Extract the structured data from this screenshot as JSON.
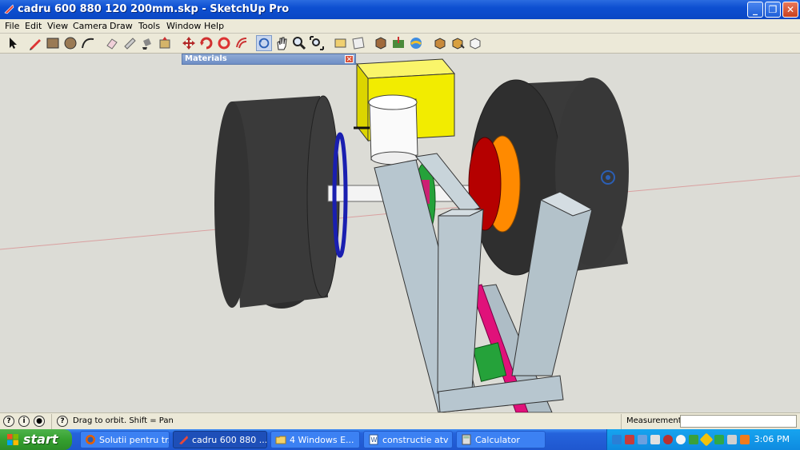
{
  "window": {
    "title": "cadru 600 880 120 200mm.skp - SketchUp Pro",
    "controls": [
      "minimize",
      "maximize",
      "close"
    ]
  },
  "menu": [
    "File",
    "Edit",
    "View",
    "Camera",
    "Draw",
    "Tools",
    "Window",
    "Help"
  ],
  "toolbar": {
    "icons": [
      "select-icon",
      "pencil-icon",
      "rectangle-icon",
      "circle-icon",
      "arc-icon",
      "eraser-icon",
      "tape-measure-icon",
      "paint-bucket-icon",
      "push-pull-icon",
      "move-icon",
      "rotate-icon",
      "follow-me-icon",
      "orbit-icon",
      "pan-icon",
      "zoom-icon",
      "zoom-extents-icon",
      "section-icon",
      "preview-icon",
      "components-icon",
      "geo-location-icon",
      "styles-icon",
      "upload-icon",
      "download-icon",
      "share-icon"
    ],
    "active": "orbit-icon"
  },
  "materials_panel": {
    "title": "Materials"
  },
  "status": {
    "text": "Drag to orbit.  Shift = Pan",
    "measurements_label": "Measurements",
    "measurements_value": ""
  },
  "taskbar": {
    "start_label": "start",
    "tasks": [
      {
        "label": "Solutii pentru tr...",
        "icon": "firefox-icon",
        "active": false
      },
      {
        "label": "cadru 600 880 ...",
        "icon": "sketchup-icon",
        "active": true
      },
      {
        "label": "4 Windows E...",
        "icon": "folder-icon",
        "active": false
      },
      {
        "label": "constructie atv ...",
        "icon": "word-icon",
        "active": false
      },
      {
        "label": "Calculator",
        "icon": "calculator-icon",
        "active": false
      }
    ],
    "clock": "3:06 PM"
  },
  "colors": {
    "title_bar": "#0d4fd1",
    "viewport_bg": "#dcdcd6",
    "tire": "#3a3a3a",
    "frame": "#b7c6cf",
    "motor": "#f2ec00",
    "disc_red": "#b50000",
    "disc_orange": "#ff8a00",
    "gear_green": "#25a23a",
    "disc_blue": "#1a1fb0",
    "shaft_pink": "#e0117a"
  }
}
